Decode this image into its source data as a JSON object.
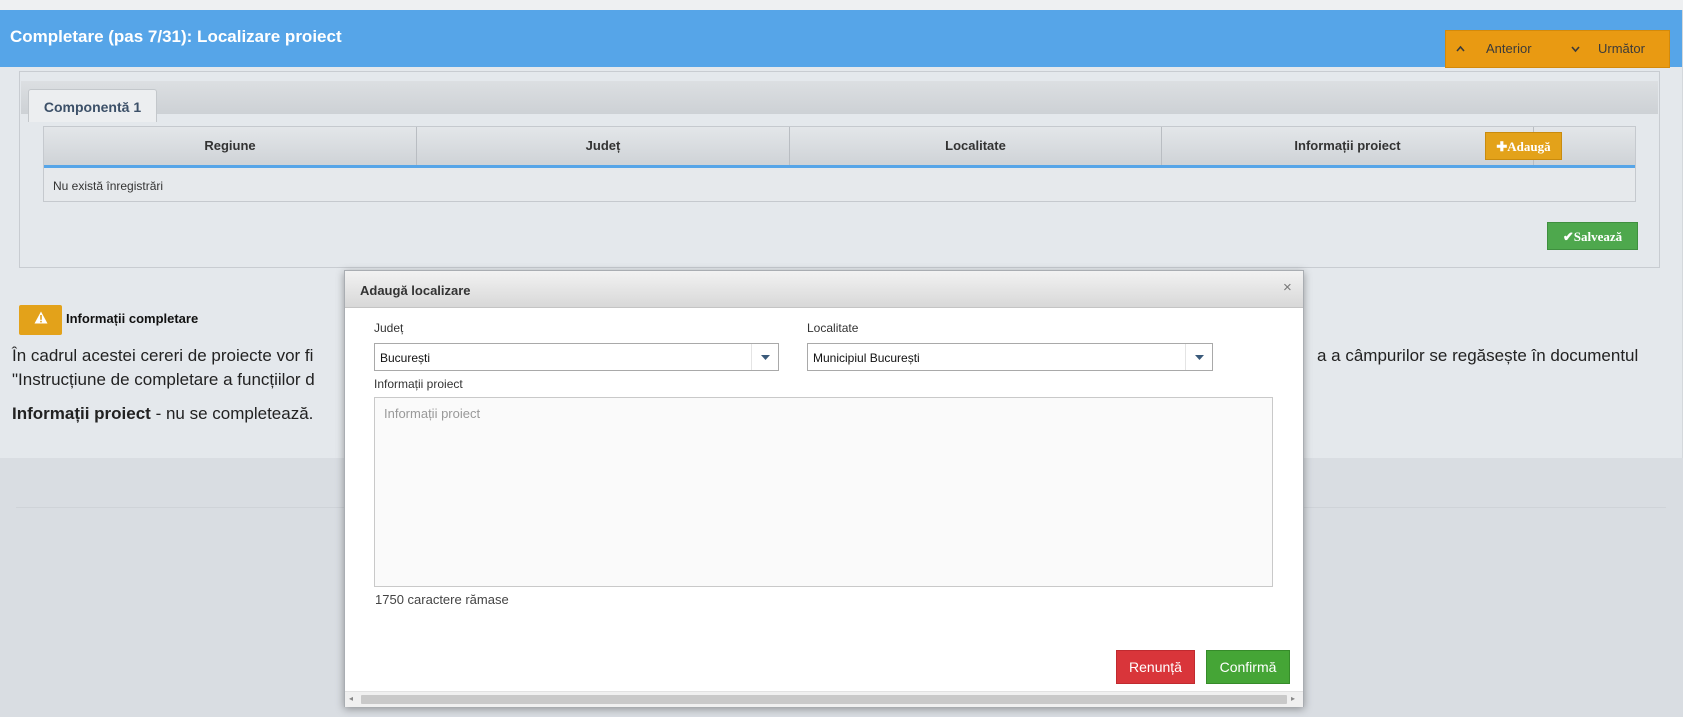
{
  "header": {
    "title": "Completare (pas 7/31): Localizare proiect",
    "prev_label": "Anterior",
    "next_label": "Următor"
  },
  "component": {
    "tab_label": "Componentă 1",
    "columns": [
      "Regiune",
      "Județ",
      "Localitate",
      "Informații proiect"
    ],
    "add_label": "Adaugă",
    "empty_text": "Nu există înregistrări",
    "save_label": "Salvează"
  },
  "info": {
    "title": "Informații completare",
    "line1_start": "În cadrul acestei cereri de proiecte vor fi",
    "line1_end": "a a câmpurilor  se regăsește în documentul",
    "line2": "\"Instrucțiune de completare a funcțiilor d",
    "line3_bold": "Informații proiect",
    "line3_rest": " - nu se completează."
  },
  "modal": {
    "title": "Adaugă localizare",
    "judet_label": "Județ",
    "judet_value": "București",
    "localitate_label": "Localitate",
    "localitate_value": "Municipiul București",
    "info_label": "Informații proiect",
    "info_placeholder": "Informații proiect",
    "chars_remaining": "1750 caractere rămase",
    "cancel_label": "Renunță",
    "confirm_label": "Confirmă"
  },
  "colors": {
    "header_blue": "#56a5e8",
    "accent_orange": "#e3a21a",
    "save_green": "#4ea84d",
    "cancel_red": "#d9353a",
    "confirm_green": "#45a536"
  }
}
